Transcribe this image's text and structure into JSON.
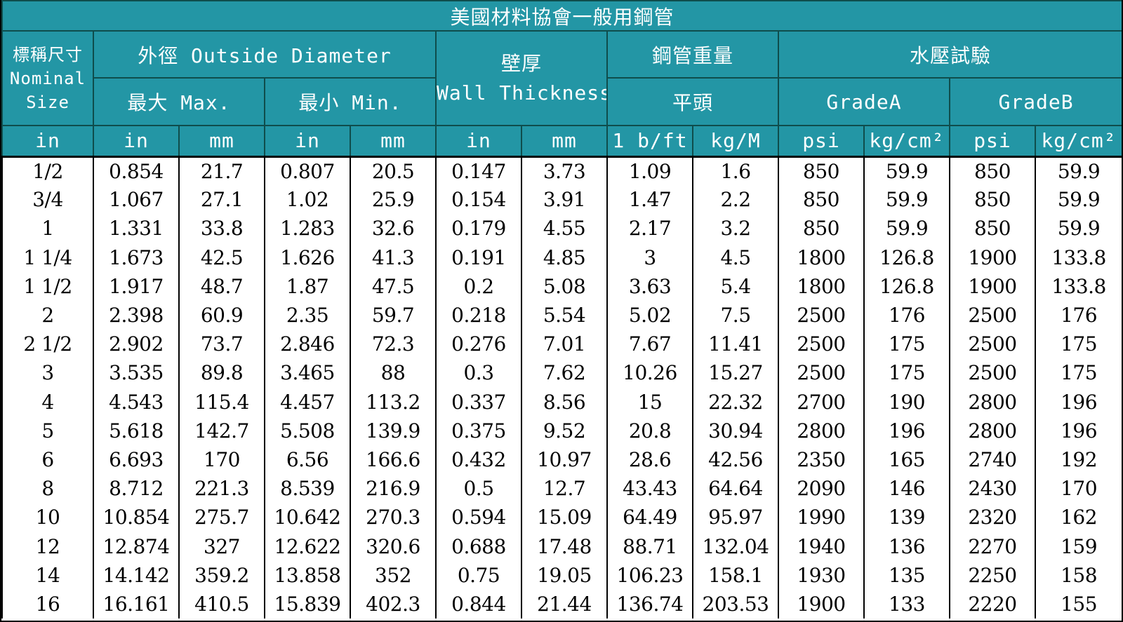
{
  "title": "美國材料協會一般用鋼管",
  "headers": {
    "nominal_size": [
      "標稱尺寸",
      "Nominal",
      "Size"
    ],
    "outside_diameter": "外徑 Outside Diameter",
    "od_max": "最大 Max.",
    "od_min": "最小 Min.",
    "wall_thickness_cn": "壁厚",
    "wall_thickness_en": "Wall Thickness",
    "pipe_weight": "鋼管重量",
    "plain_end": "平頭",
    "hydro_test": "水壓試驗",
    "grade_a": "GradeA",
    "grade_b": "GradeB"
  },
  "units": [
    "in",
    "in",
    "mm",
    "in",
    "mm",
    "in",
    "mm",
    "1 b/ft",
    "kg/M",
    "psi",
    "kg/cm²",
    "psi",
    "kg/cm²"
  ],
  "rows": [
    [
      "1/2",
      "0.854",
      "21.7",
      "0.807",
      "20.5",
      "0.147",
      "3.73",
      "1.09",
      "1.6",
      "850",
      "59.9",
      "850",
      "59.9"
    ],
    [
      "3/4",
      "1.067",
      "27.1",
      "1.02",
      "25.9",
      "0.154",
      "3.91",
      "1.47",
      "2.2",
      "850",
      "59.9",
      "850",
      "59.9"
    ],
    [
      "1",
      "1.331",
      "33.8",
      "1.283",
      "32.6",
      "0.179",
      "4.55",
      "2.17",
      "3.2",
      "850",
      "59.9",
      "850",
      "59.9"
    ],
    [
      "1 1/4",
      "1.673",
      "42.5",
      "1.626",
      "41.3",
      "0.191",
      "4.85",
      "3",
      "4.5",
      "1800",
      "126.8",
      "1900",
      "133.8"
    ],
    [
      "1 1/2",
      "1.917",
      "48.7",
      "1.87",
      "47.5",
      "0.2",
      "5.08",
      "3.63",
      "5.4",
      "1800",
      "126.8",
      "1900",
      "133.8"
    ],
    [
      "2",
      "2.398",
      "60.9",
      "2.35",
      "59.7",
      "0.218",
      "5.54",
      "5.02",
      "7.5",
      "2500",
      "176",
      "2500",
      "176"
    ],
    [
      "2 1/2",
      "2.902",
      "73.7",
      "2.846",
      "72.3",
      "0.276",
      "7.01",
      "7.67",
      "11.41",
      "2500",
      "175",
      "2500",
      "175"
    ],
    [
      "3",
      "3.535",
      "89.8",
      "3.465",
      "88",
      "0.3",
      "7.62",
      "10.26",
      "15.27",
      "2500",
      "175",
      "2500",
      "175"
    ],
    [
      "4",
      "4.543",
      "115.4",
      "4.457",
      "113.2",
      "0.337",
      "8.56",
      "15",
      "22.32",
      "2700",
      "190",
      "2800",
      "196"
    ],
    [
      "5",
      "5.618",
      "142.7",
      "5.508",
      "139.9",
      "0.375",
      "9.52",
      "20.8",
      "30.94",
      "2800",
      "196",
      "2800",
      "196"
    ],
    [
      "6",
      "6.693",
      "170",
      "6.56",
      "166.6",
      "0.432",
      "10.97",
      "28.6",
      "42.56",
      "2350",
      "165",
      "2740",
      "192"
    ],
    [
      "8",
      "8.712",
      "221.3",
      "8.539",
      "216.9",
      "0.5",
      "12.7",
      "43.43",
      "64.64",
      "2090",
      "146",
      "2430",
      "170"
    ],
    [
      "10",
      "10.854",
      "275.7",
      "10.642",
      "270.3",
      "0.594",
      "15.09",
      "64.49",
      "95.97",
      "1990",
      "139",
      "2320",
      "162"
    ],
    [
      "12",
      "12.874",
      "327",
      "12.622",
      "320.6",
      "0.688",
      "17.48",
      "88.71",
      "132.04",
      "1940",
      "136",
      "2270",
      "159"
    ],
    [
      "14",
      "14.142",
      "359.2",
      "13.858",
      "352",
      "0.75",
      "19.05",
      "106.23",
      "158.1",
      "1930",
      "135",
      "2250",
      "158"
    ],
    [
      "16",
      "16.161",
      "410.5",
      "15.839",
      "402.3",
      "0.844",
      "21.44",
      "136.74",
      "203.53",
      "1900",
      "133",
      "2220",
      "155"
    ]
  ],
  "colors": {
    "header_bg": "#2396a5",
    "header_border": "#0f4d4c",
    "header_text": "#ffffff",
    "body_text": "#000000"
  }
}
